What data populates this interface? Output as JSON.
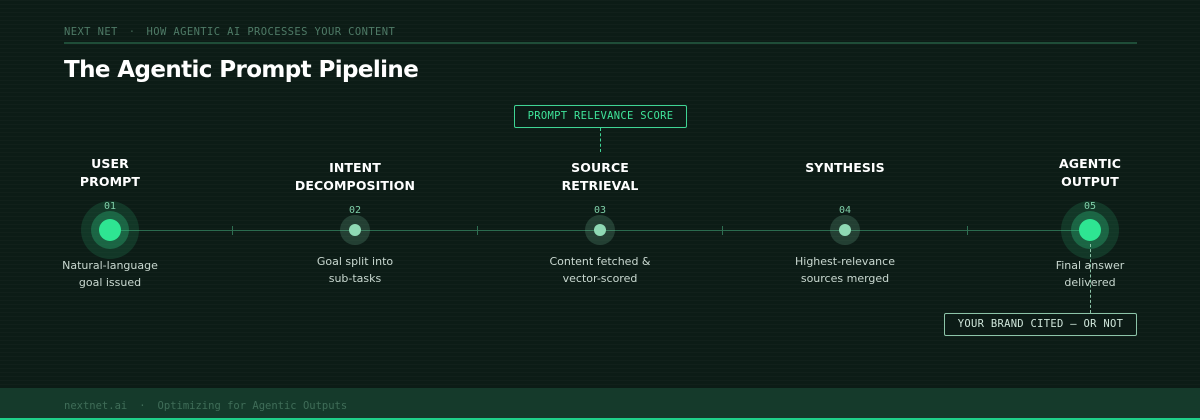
{
  "header": {
    "brand": "NEXT NET",
    "separator": "·",
    "subtitle": "HOW AGENTIC AI PROCESSES YOUR CONTENT",
    "title": "The Agentic Prompt Pipeline"
  },
  "stages": [
    {
      "number": "01",
      "title_line1": "USER",
      "title_line2": "PROMPT",
      "desc_line1": "Natural-language",
      "desc_line2": "goal issued",
      "emphasis": "endpoint"
    },
    {
      "number": "02",
      "title_line1": "INTENT",
      "title_line2": "DECOMPOSITION",
      "desc_line1": "Goal split into",
      "desc_line2": "sub-tasks",
      "emphasis": "step"
    },
    {
      "number": "03",
      "title_line1": "SOURCE",
      "title_line2": "RETRIEVAL",
      "desc_line1": "Content fetched &",
      "desc_line2": "vector-scored",
      "emphasis": "step"
    },
    {
      "number": "04",
      "title_line1": "SYNTHESIS",
      "title_line2": "",
      "desc_line1": "Highest-relevance",
      "desc_line2": "sources merged",
      "emphasis": "step"
    },
    {
      "number": "05",
      "title_line1": "AGENTIC",
      "title_line2": "OUTPUT",
      "desc_line1": "Final answer",
      "desc_line2": "delivered",
      "emphasis": "endpoint"
    }
  ],
  "callouts": {
    "relevance": "PROMPT RELEVANCE SCORE",
    "brand": "YOUR BRAND CITED — OR NOT"
  },
  "footer": {
    "site": "nextnet.ai",
    "separator": "·",
    "tagline": "Optimizing for Agentic Outputs"
  },
  "colors": {
    "background": "#0c1c16",
    "accent": "#2ee592",
    "muted_accent": "#8fd9b4",
    "footer_band": "#153a2b"
  }
}
